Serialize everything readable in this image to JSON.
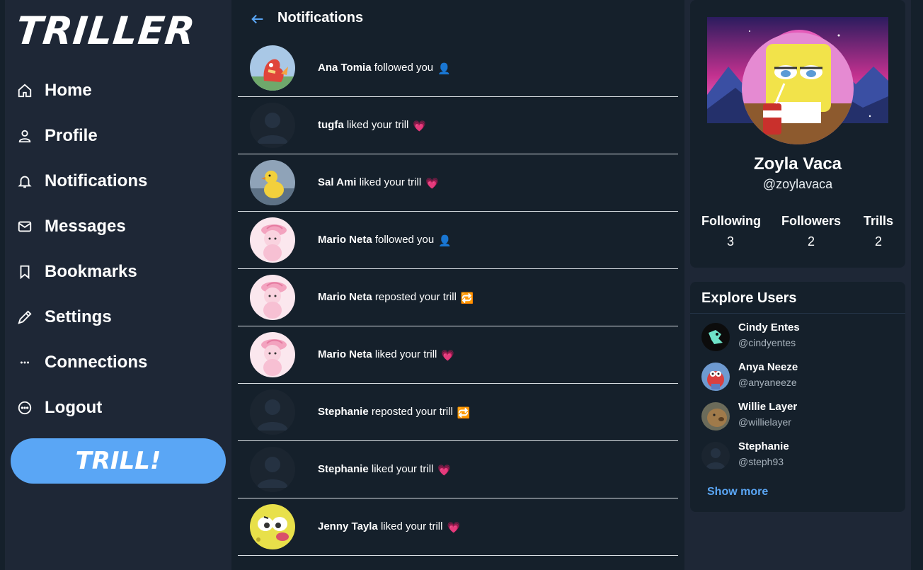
{
  "app": {
    "logo": "TRILLER"
  },
  "sidebar": {
    "items": [
      {
        "label": "Home",
        "icon": "home-icon"
      },
      {
        "label": "Profile",
        "icon": "user-icon"
      },
      {
        "label": "Notifications",
        "icon": "bell-icon"
      },
      {
        "label": "Messages",
        "icon": "envelope-icon"
      },
      {
        "label": "Bookmarks",
        "icon": "bookmark-icon"
      },
      {
        "label": "Settings",
        "icon": "pencil-icon"
      },
      {
        "label": "Connections",
        "icon": "dots-icon"
      },
      {
        "label": "Logout",
        "icon": "circle-dots-icon"
      }
    ],
    "trill_button": "TRILL!"
  },
  "main": {
    "title": "Notifications",
    "notifications": [
      {
        "user": "Ana Tomia",
        "action": "followed you",
        "emoji": "👤",
        "avatar": "charmeleon-avatar"
      },
      {
        "user": "tugfa",
        "action": "liked your trill",
        "emoji": "💗",
        "avatar": "default-avatar"
      },
      {
        "user": "Sal Ami",
        "action": "liked your trill",
        "emoji": "💗",
        "avatar": "duckling-avatar"
      },
      {
        "user": "Mario Neta",
        "action": "followed you",
        "emoji": "👤",
        "avatar": "pink-character-avatar"
      },
      {
        "user": "Mario Neta",
        "action": "reposted your trill",
        "emoji": "🔁",
        "avatar": "pink-character-avatar"
      },
      {
        "user": "Mario Neta",
        "action": "liked your trill",
        "emoji": "💗",
        "avatar": "pink-character-avatar"
      },
      {
        "user": "Stephanie",
        "action": "reposted your trill",
        "emoji": "🔁",
        "avatar": "default-avatar"
      },
      {
        "user": "Stephanie",
        "action": "liked your trill",
        "emoji": "💗",
        "avatar": "default-avatar"
      },
      {
        "user": "Jenny Tayla",
        "action": "liked your trill",
        "emoji": "💗",
        "avatar": "spongebob-avatar"
      }
    ]
  },
  "profile": {
    "name": "Zoyla Vaca",
    "handle": "@zoylavaca",
    "stats": [
      {
        "label": "Following",
        "value": "3"
      },
      {
        "label": "Followers",
        "value": "2"
      },
      {
        "label": "Trills",
        "value": "2"
      }
    ]
  },
  "explore": {
    "title": "Explore Users",
    "users": [
      {
        "name": "Cindy Entes",
        "handle": "@cindyentes"
      },
      {
        "name": "Anya Neeze",
        "handle": "@anyaneeze"
      },
      {
        "name": "Willie Layer",
        "handle": "@willielayer"
      },
      {
        "name": "Stephanie",
        "handle": "@steph93"
      }
    ],
    "show_more": "Show more"
  },
  "colors": {
    "accent": "#5aa6f5",
    "background": "#15202b",
    "panel": "#1e2736"
  }
}
